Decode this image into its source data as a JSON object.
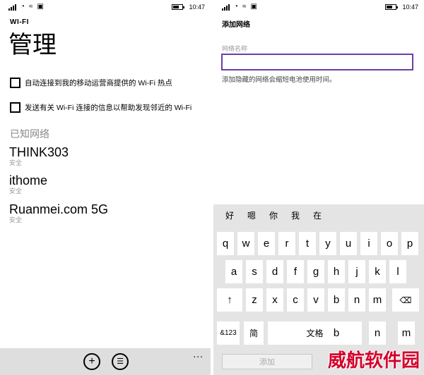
{
  "status_bar": {
    "time": "10:47"
  },
  "left": {
    "app_title": "WI-FI",
    "page_title": "管理",
    "options": [
      {
        "label": "自动连接到我的移动运营商提供的 Wi-Fi 热点",
        "checked": false
      },
      {
        "label": "发送有关 Wi-Fi 连接的信息以帮助发现邻近的 Wi-Fi",
        "checked": false
      }
    ],
    "known_header": "已知网络",
    "networks": [
      {
        "name": "THINK303",
        "status": "安全"
      },
      {
        "name": "ithome",
        "status": "安全"
      },
      {
        "name": "Ruanmei.com 5G",
        "status": "安全"
      }
    ],
    "app_bar": {
      "add_icon": "add-icon",
      "list_icon": "list-icon",
      "more": "..."
    }
  },
  "right": {
    "title": "添加网络",
    "field_label": "网络名称",
    "field_value": "",
    "hint": "添加隐藏的网络会缩短电池使用时间。",
    "keyboard": {
      "candidates": [
        "好",
        "嗯",
        "你",
        "我",
        "在"
      ],
      "row1": [
        "q",
        "w",
        "e",
        "r",
        "t",
        "y",
        "u",
        "i",
        "o",
        "p"
      ],
      "row2": [
        "a",
        "s",
        "d",
        "f",
        "g",
        "h",
        "j",
        "k",
        "l"
      ],
      "row3_keys": [
        "z",
        "x",
        "c",
        "v",
        "b",
        "n",
        "m"
      ],
      "shift_icon": "shift-arrow-icon",
      "backspace_icon": "backspace-icon",
      "num_key": "&123",
      "lang_key": "简",
      "space_label": "文格",
      "row4_letters": [
        "b",
        "n",
        "m"
      ]
    },
    "add_button": "添加",
    "watermark": "威航软件园"
  },
  "colors": {
    "accent": "#6a3fa8",
    "app_bar": "#dedede",
    "keyboard_bg": "#e4e4e4",
    "watermark": "#d4002a"
  }
}
